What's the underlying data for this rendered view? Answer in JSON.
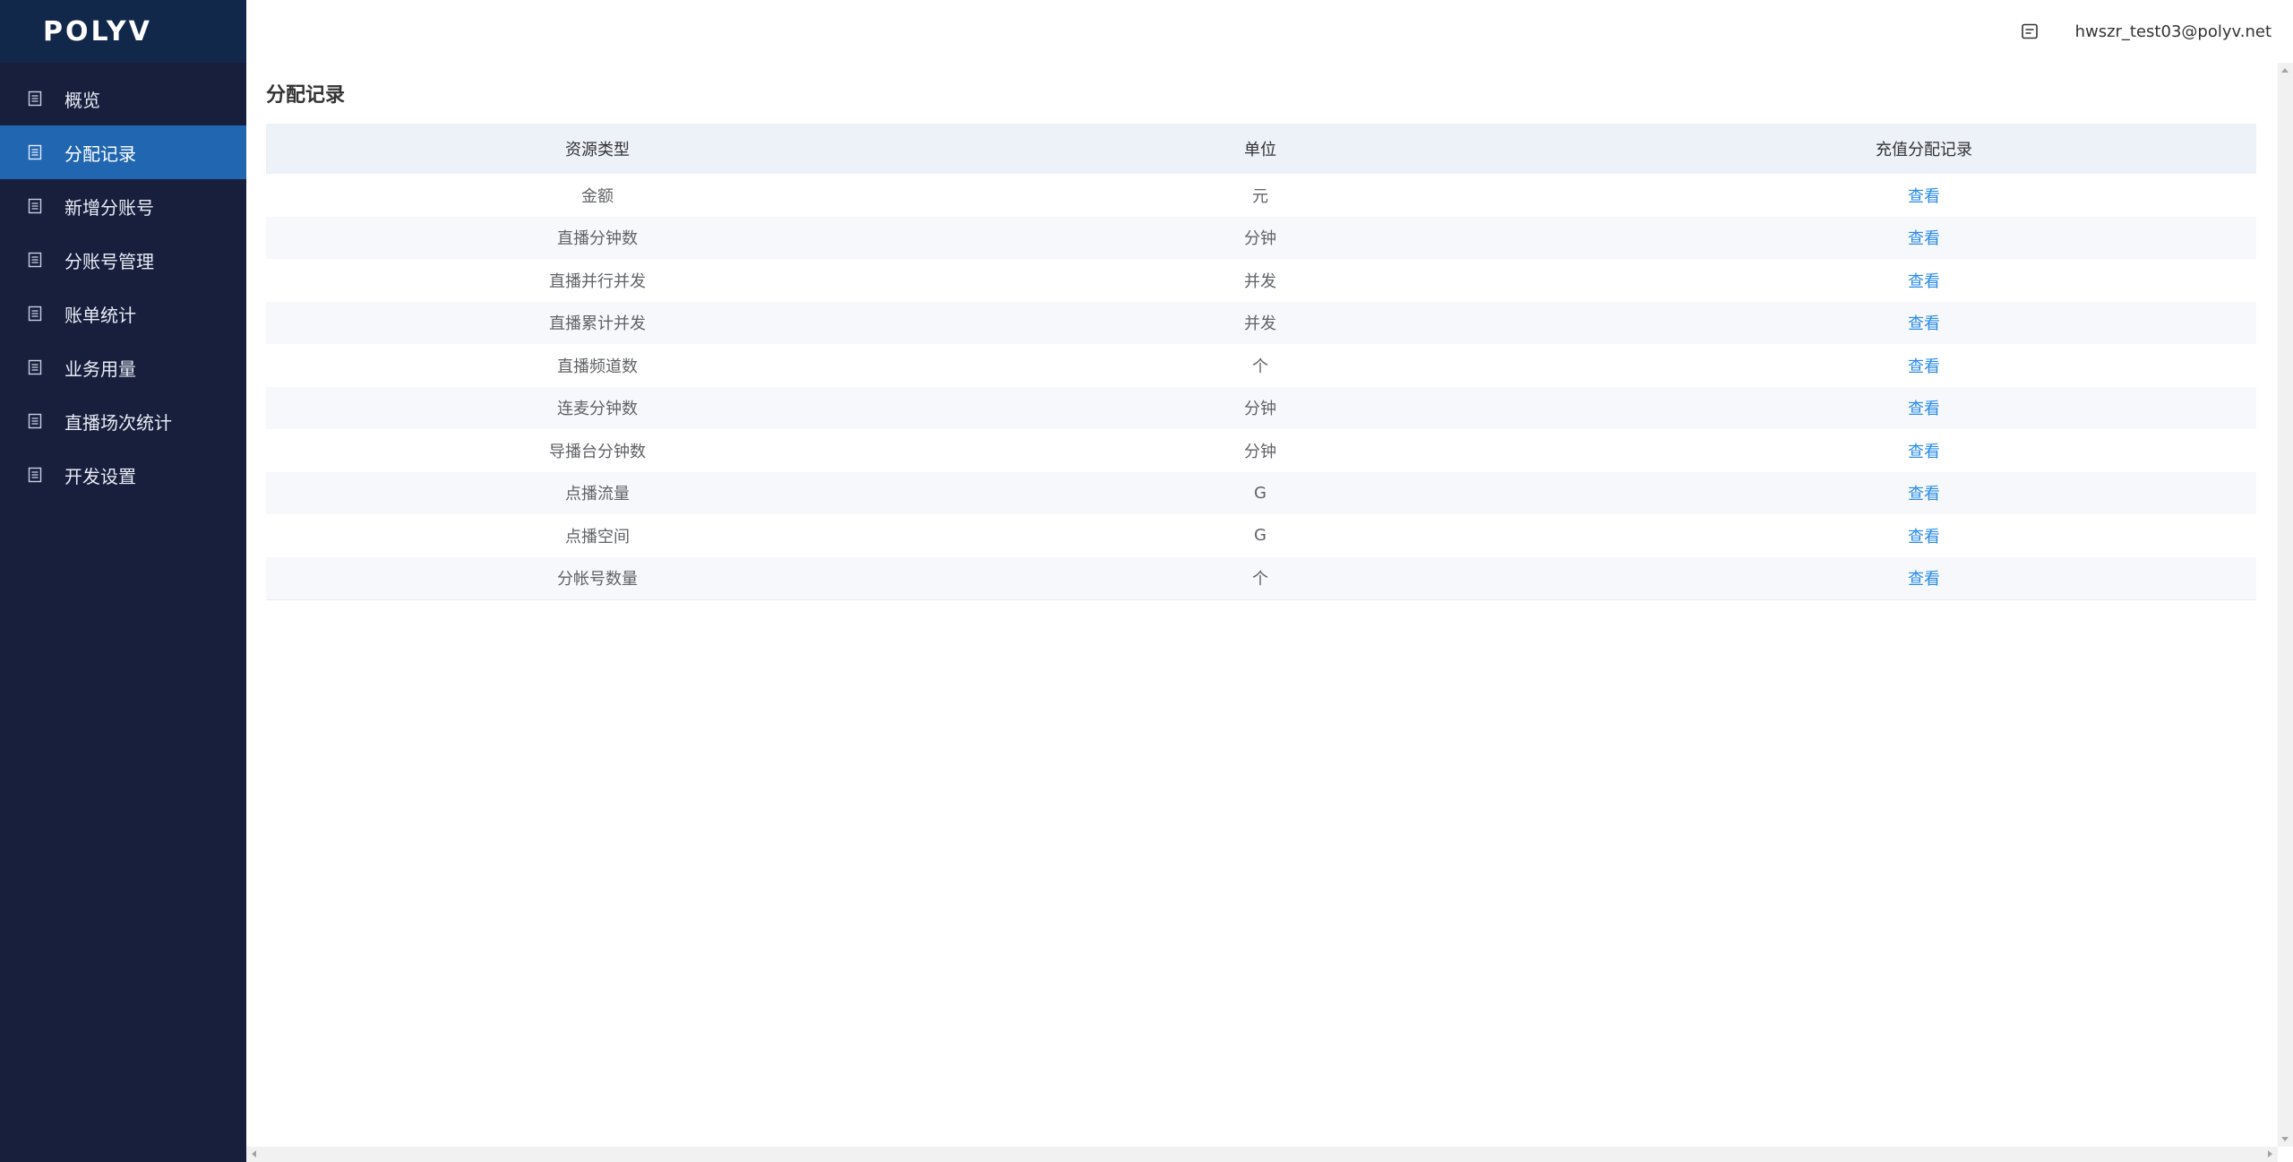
{
  "brand": {
    "logo_text": "POLYV"
  },
  "sidebar": {
    "items": [
      {
        "label": "概览",
        "icon": "list-doc-icon"
      },
      {
        "label": "分配记录",
        "icon": "list-doc-icon",
        "active": true
      },
      {
        "label": "新增分账号",
        "icon": "list-doc-icon"
      },
      {
        "label": "分账号管理",
        "icon": "list-doc-icon"
      },
      {
        "label": "账单统计",
        "icon": "list-doc-icon"
      },
      {
        "label": "业务用量",
        "icon": "list-doc-icon"
      },
      {
        "label": "直播场次统计",
        "icon": "list-doc-icon"
      },
      {
        "label": "开发设置",
        "icon": "list-doc-icon"
      }
    ]
  },
  "header": {
    "user_email": "hwszr_test03@polyv.net",
    "notice_icon": "message-icon"
  },
  "main": {
    "title": "分配记录",
    "table": {
      "columns": [
        "资源类型",
        "单位",
        "充值分配记录"
      ],
      "rows": [
        {
          "type": "金额",
          "unit": "元",
          "action": "查看"
        },
        {
          "type": "直播分钟数",
          "unit": "分钟",
          "action": "查看"
        },
        {
          "type": "直播并行并发",
          "unit": "并发",
          "action": "查看"
        },
        {
          "type": "直播累计并发",
          "unit": "并发",
          "action": "查看"
        },
        {
          "type": "直播频道数",
          "unit": "个",
          "action": "查看"
        },
        {
          "type": "连麦分钟数",
          "unit": "分钟",
          "action": "查看"
        },
        {
          "type": "导播台分钟数",
          "unit": "分钟",
          "action": "查看"
        },
        {
          "type": "点播流量",
          "unit": "G",
          "action": "查看"
        },
        {
          "type": "点播空间",
          "unit": "G",
          "action": "查看"
        },
        {
          "type": "分帐号数量",
          "unit": "个",
          "action": "查看"
        }
      ]
    }
  },
  "colors": {
    "sidebar_bg": "#171f3d",
    "logo_bg": "#12284a",
    "active_item": "#2166b0",
    "link": "#2b8be6",
    "table_header_bg": "#edf1f8"
  }
}
